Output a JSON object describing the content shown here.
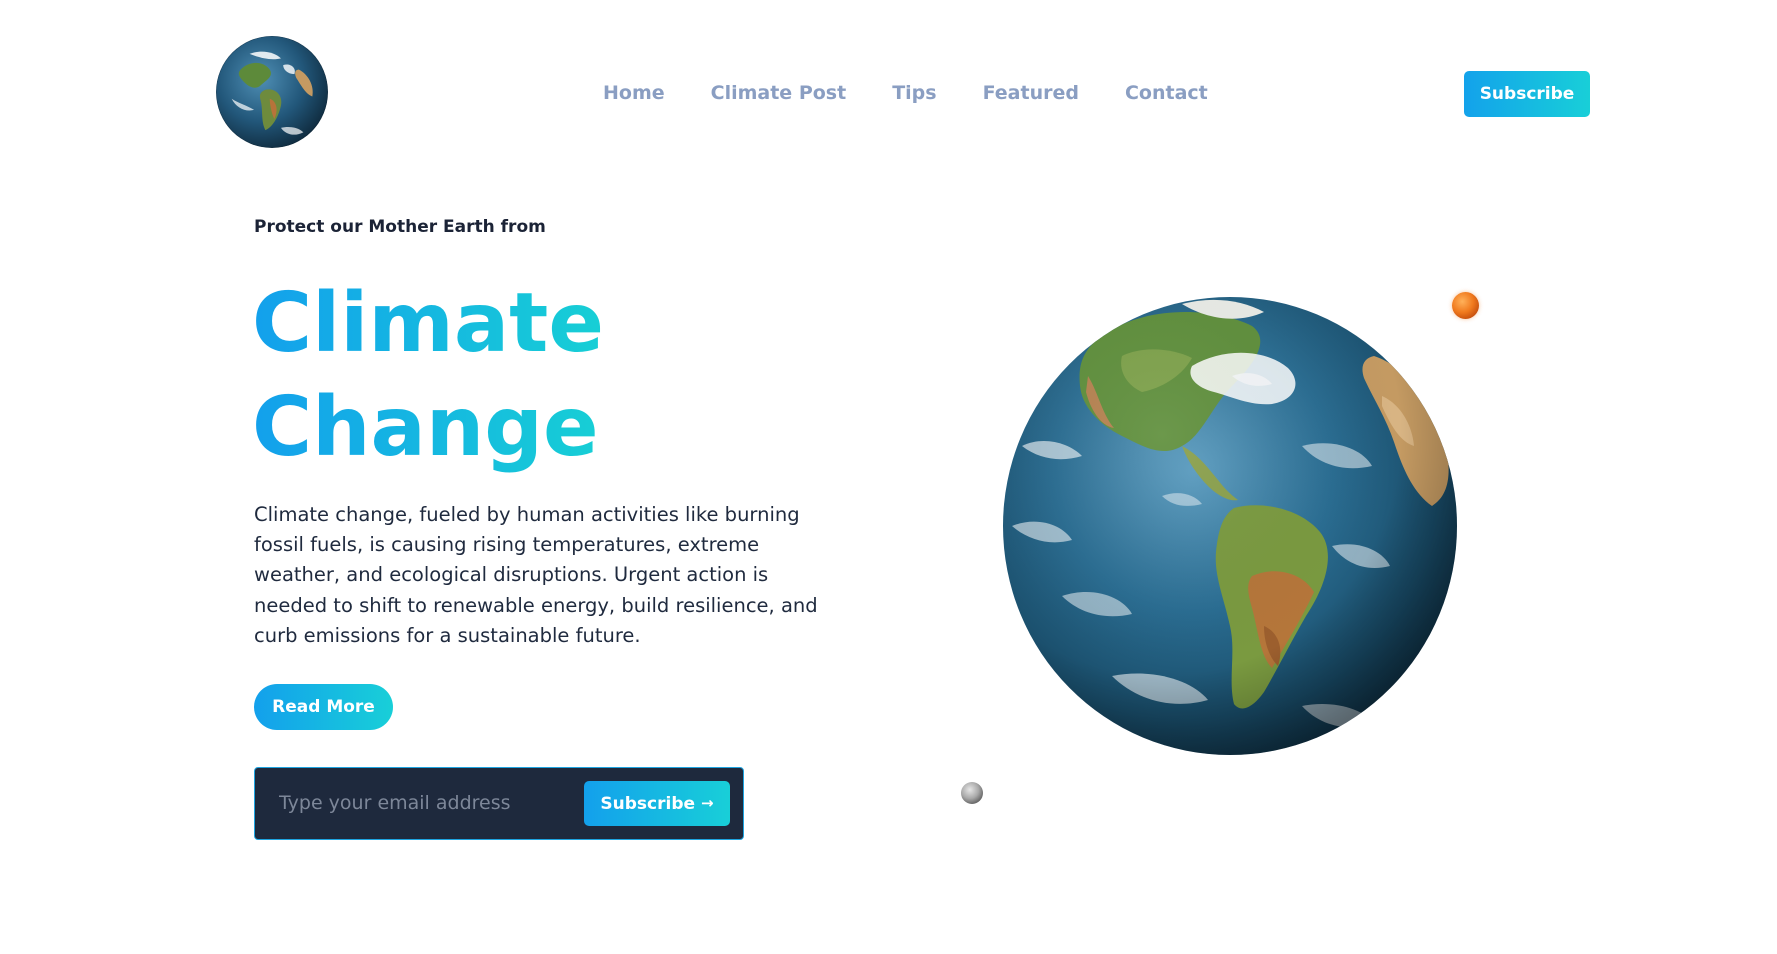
{
  "header": {
    "logo_icon": "earth-globe-icon",
    "nav": [
      {
        "label": "Home"
      },
      {
        "label": "Climate Post"
      },
      {
        "label": "Tips"
      },
      {
        "label": "Featured"
      },
      {
        "label": "Contact"
      }
    ],
    "subscribe_label": "Subscribe"
  },
  "hero": {
    "eyebrow": "Protect our Mother Earth from",
    "title_line1": "Climate",
    "title_line2": "Change",
    "description": "Climate change, fueled by human activities like burning fossil fuels, is causing rising temperatures, extreme weather, and ecological disruptions. Urgent action is needed to shift to renewable energy, build resilience, and curb emissions for a sustainable future.",
    "read_more_label": "Read More"
  },
  "subscribe_form": {
    "email_value": "",
    "email_placeholder": "Type your email address",
    "submit_label": "Subscribe",
    "submit_icon": "arrow-right-icon"
  },
  "illustration": {
    "earth_icon": "earth-globe-icon",
    "mars_icon": "planet-mars-icon",
    "moon_icon": "moon-icon"
  },
  "colors": {
    "accent_start": "#13a0ec",
    "accent_end": "#18cfd8",
    "nav_text": "#8a9ec2",
    "body_text": "#1f2a3e",
    "form_bg": "#1e293d"
  }
}
